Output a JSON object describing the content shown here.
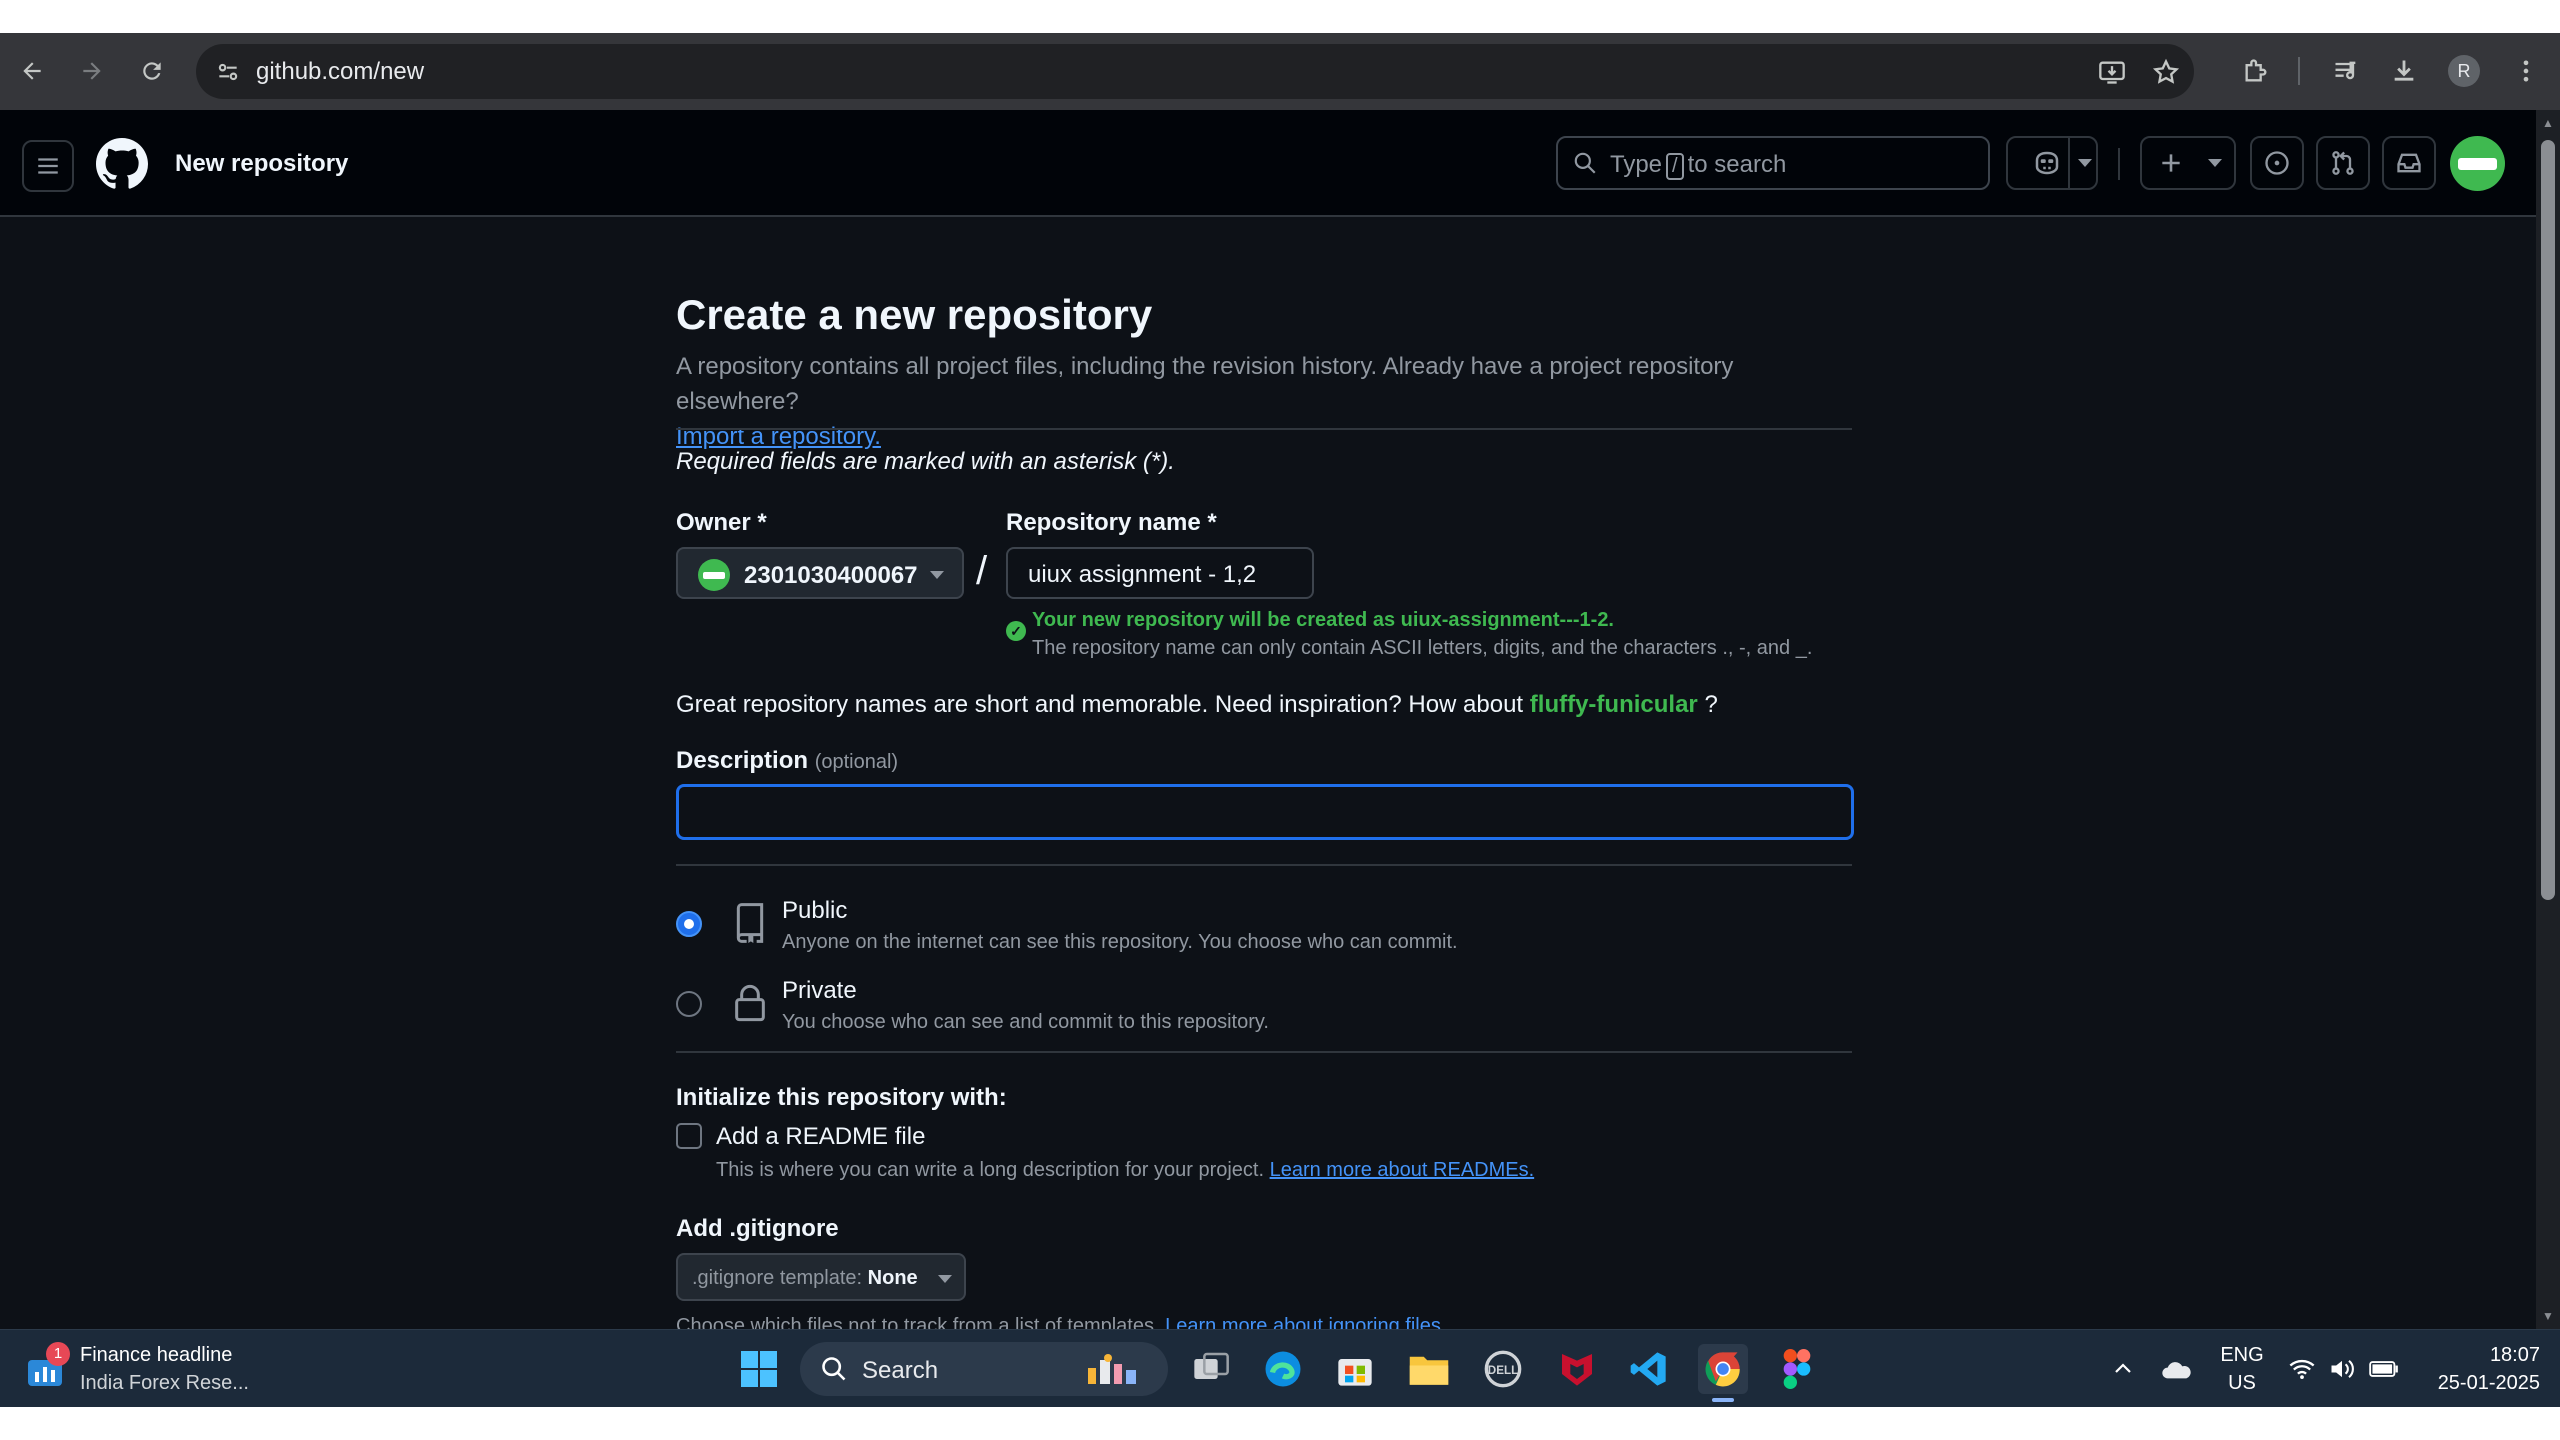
{
  "browser": {
    "url": "github.com/new",
    "profile_initial": "R"
  },
  "header": {
    "title": "New repository",
    "search_prefix": "Type",
    "search_key": "/",
    "search_suffix": "to search"
  },
  "page": {
    "heading": "Create a new repository",
    "description": "A repository contains all project files, including the revision history. Already have a project repository elsewhere?",
    "import_link": "Import a repository.",
    "required_note": "Required fields are marked with an asterisk (*).",
    "owner_label": "Owner *",
    "owner_value": "2301030400067",
    "repo_label": "Repository name *",
    "repo_value": "uiux assignment - 1,2",
    "slash": "/",
    "validation_ok": "Your new repository will be created as uiux-assignment---1-2.",
    "validation_hint": "The repository name can only contain ASCII letters, digits, and the characters ., -, and _.",
    "inspiration_prefix": "Great repository names are short and memorable. Need inspiration? How about",
    "inspiration_name": "fluffy-funicular",
    "inspiration_suffix": "?",
    "description_label": "Description",
    "description_optional": "(optional)",
    "description_value": "",
    "visibility": {
      "selected": "public",
      "public_title": "Public",
      "public_desc": "Anyone on the internet can see this repository. You choose who can commit.",
      "private_title": "Private",
      "private_desc": "You choose who can see and commit to this repository."
    },
    "init_label": "Initialize this repository with:",
    "readme_label": "Add a README file",
    "readme_desc": "This is where you can write a long description for your project.",
    "readme_link": "Learn more about READMEs.",
    "readme_checked": false,
    "gitignore_label": "Add .gitignore",
    "gitignore_prefix": ".gitignore template:",
    "gitignore_value": "None",
    "gitignore_hint": "Choose which files not to track from a list of templates.",
    "gitignore_link": "Learn more about ignoring files."
  },
  "taskbar": {
    "widget_badge": "1",
    "widget_title": "Finance headline",
    "widget_sub": "India Forex Rese...",
    "search_label": "Search",
    "lang_line1": "ENG",
    "lang_line2": "US",
    "time": "18:07",
    "date": "25-01-2025"
  },
  "colors": {
    "page_bg": "#0d1117",
    "header_bg": "#010409",
    "accent_blue": "#1f6feb",
    "success_green": "#3fb950",
    "link_blue": "#4493f8"
  }
}
